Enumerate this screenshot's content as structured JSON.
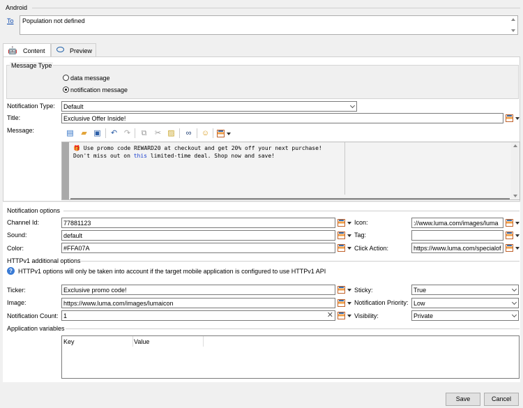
{
  "android": {
    "title": "Android",
    "to_link": "To",
    "population": "Population not defined"
  },
  "tabs": [
    {
      "label": "Content",
      "icon": "android-icon",
      "active": true
    },
    {
      "label": "Preview",
      "icon": "eye-icon",
      "active": false
    }
  ],
  "message_type": {
    "title": "Message Type",
    "options": [
      {
        "label": "data message",
        "selected": false
      },
      {
        "label": "notification message",
        "selected": true
      }
    ]
  },
  "form": {
    "notification_type_label": "Notification Type:",
    "notification_type_value": "Default",
    "title_label": "Title:",
    "title_value": "Exclusive Offer Inside!",
    "message_label": "Message:",
    "message_line1": "🎁 Use promo code REWARD20 at checkout and get 20% off your next purchase!",
    "message_line2_a": "Don't miss out on ",
    "message_line2_kw": "this",
    "message_line2_b": " limited-time deal. Shop now and save!"
  },
  "notification_options": {
    "title": "Notification options",
    "channel_id_label": "Channel Id:",
    "channel_id_value": "77881123",
    "sound_label": "Sound:",
    "sound_value": "default",
    "color_label": "Color:",
    "color_value": "#FFA07A",
    "icon_label": "Icon:",
    "icon_value": "://www.luma.com/images/luma",
    "tag_label": "Tag:",
    "tag_value": "",
    "click_action_label": "Click Action:",
    "click_action_value": "https://www.luma.com/specialof"
  },
  "httpv1": {
    "title": "HTTPv1 additional options",
    "info": "HTTPv1 options will only be taken into account if the target mobile application is configured to use HTTPv1 API",
    "ticker_label": "Ticker:",
    "ticker_value": "Exclusive promo code!",
    "image_label": "Image:",
    "image_value": "https://www.luma.com/images/lumaicon",
    "notif_count_label": "Notification Count:",
    "notif_count_value": "1",
    "sticky_label": "Sticky:",
    "sticky_value": "True",
    "priority_label": "Notification Priority:",
    "priority_value": "Low",
    "visibility_label": "Visibility:",
    "visibility_value": "Private"
  },
  "app_vars": {
    "title": "Application variables",
    "columns": [
      "Key",
      "Value"
    ]
  },
  "buttons": {
    "save": "Save",
    "cancel": "Cancel"
  },
  "colors": {
    "link": "#0645ad",
    "info": "#3a7bd5",
    "picker_orange": "#f1a14b"
  }
}
